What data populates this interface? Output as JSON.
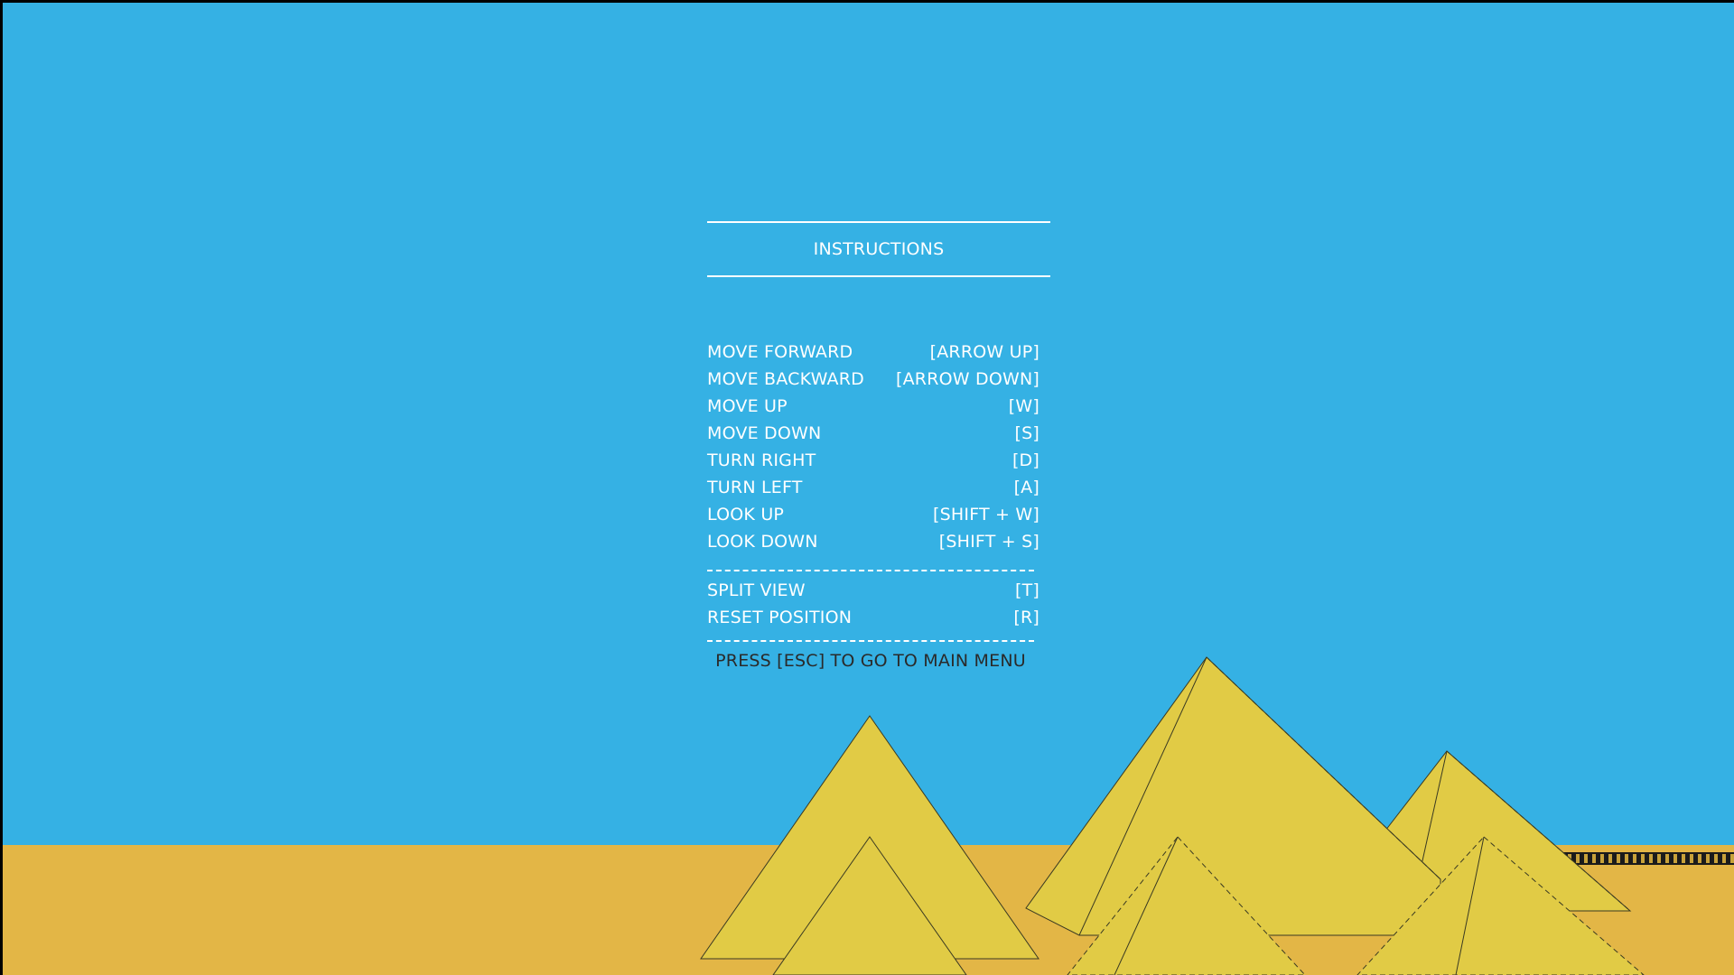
{
  "screen": {
    "title": "INSTRUCTIONS",
    "controls": [
      {
        "action": "MOVE FORWARD",
        "key": "[ARROW UP]"
      },
      {
        "action": "MOVE BACKWARD",
        "key": "[ARROW DOWN]"
      },
      {
        "action": "MOVE UP",
        "key": "[W]"
      },
      {
        "action": "MOVE DOWN",
        "key": "[S]"
      },
      {
        "action": "TURN RIGHT",
        "key": "[D]"
      },
      {
        "action": "TURN LEFT",
        "key": "[A]"
      },
      {
        "action": "LOOK UP",
        "key": "[SHIFT + W]"
      },
      {
        "action": "LOOK DOWN",
        "key": "[SHIFT + S]"
      }
    ],
    "extras": [
      {
        "action": "SPLIT VIEW",
        "key": "[T]"
      },
      {
        "action": "RESET POSITION",
        "key": "[R]"
      }
    ],
    "esc_hint": "PRESS [ESC] TO GO TO MAIN MENU"
  },
  "colors": {
    "sky": "#35b1e4",
    "sand": "#e3b646",
    "pyramid": "#e1cb45",
    "pyramid_shade": "#d9c242",
    "text": "#ffffff",
    "hint_text": "#2a2a2a"
  }
}
